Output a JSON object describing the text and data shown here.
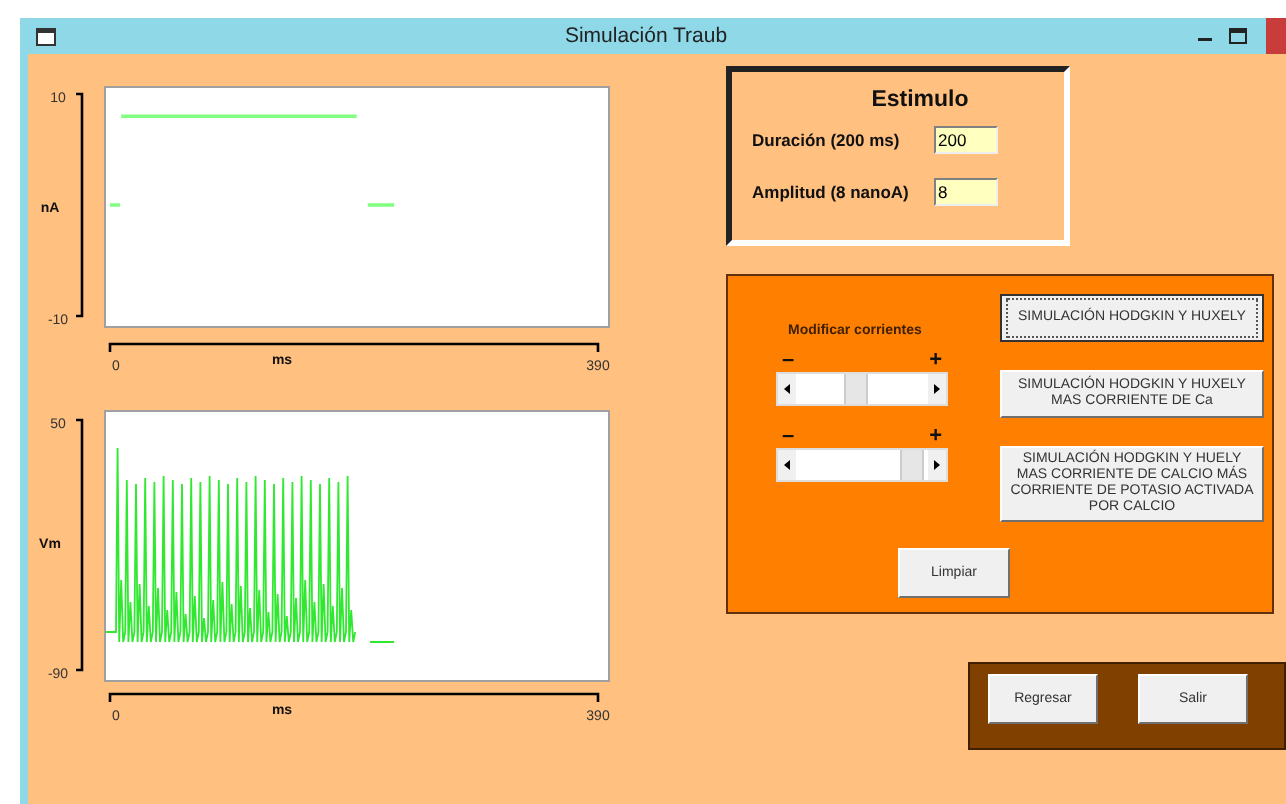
{
  "window": {
    "title": "Simulación Traub"
  },
  "current_chart": {
    "chart_data": {
      "type": "line",
      "xlabel": "ms",
      "ylabel": "nA",
      "xlim": [
        0,
        390
      ],
      "ylim": [
        -10,
        10
      ],
      "xticks": [
        0,
        390
      ],
      "yticks": [
        -10,
        10
      ],
      "x": [
        0,
        8,
        9,
        197,
        206,
        227
      ],
      "series": [
        {
          "color": "#80ff80",
          "values": [
            0,
            0,
            8,
            8,
            0,
            0
          ]
        }
      ]
    }
  },
  "voltage_plot": {
    "yticks": [
      "50",
      "-90"
    ],
    "ylabel": "Vm",
    "xticks": [
      "0",
      "390"
    ],
    "xlabel": "ms"
  },
  "stimulus": {
    "title": "Estimulo",
    "fields": [
      {
        "label": "Duración (200 ms)",
        "value": "200"
      },
      {
        "label": "Amplitud (8 nanoA)",
        "value": "8"
      }
    ]
  },
  "currents": {
    "label": "Modificar corrientes",
    "sliders": [
      {
        "minus": "–",
        "plus": "+",
        "level": 0.45
      },
      {
        "minus": "–",
        "plus": "+",
        "level": 0.88
      }
    ],
    "buttons": [
      {
        "label": "SIMULACIÓN HODGKIN Y HUXELY",
        "focused": true
      },
      {
        "label": "SIMULACIÓN HODGKIN Y HUXELY MAS CORRIENTE DE Ca",
        "focused": false
      },
      {
        "label": "SIMULACIÓN HODGKIN Y HUELY MAS CORRIENTE DE CALCIO MÁS CORRIENTE DE POTASIO ACTIVADA POR CALCIO",
        "focused": false
      }
    ],
    "clear_button": "Limpiar"
  },
  "nav_buttons": [
    "Regresar",
    "Salir"
  ]
}
